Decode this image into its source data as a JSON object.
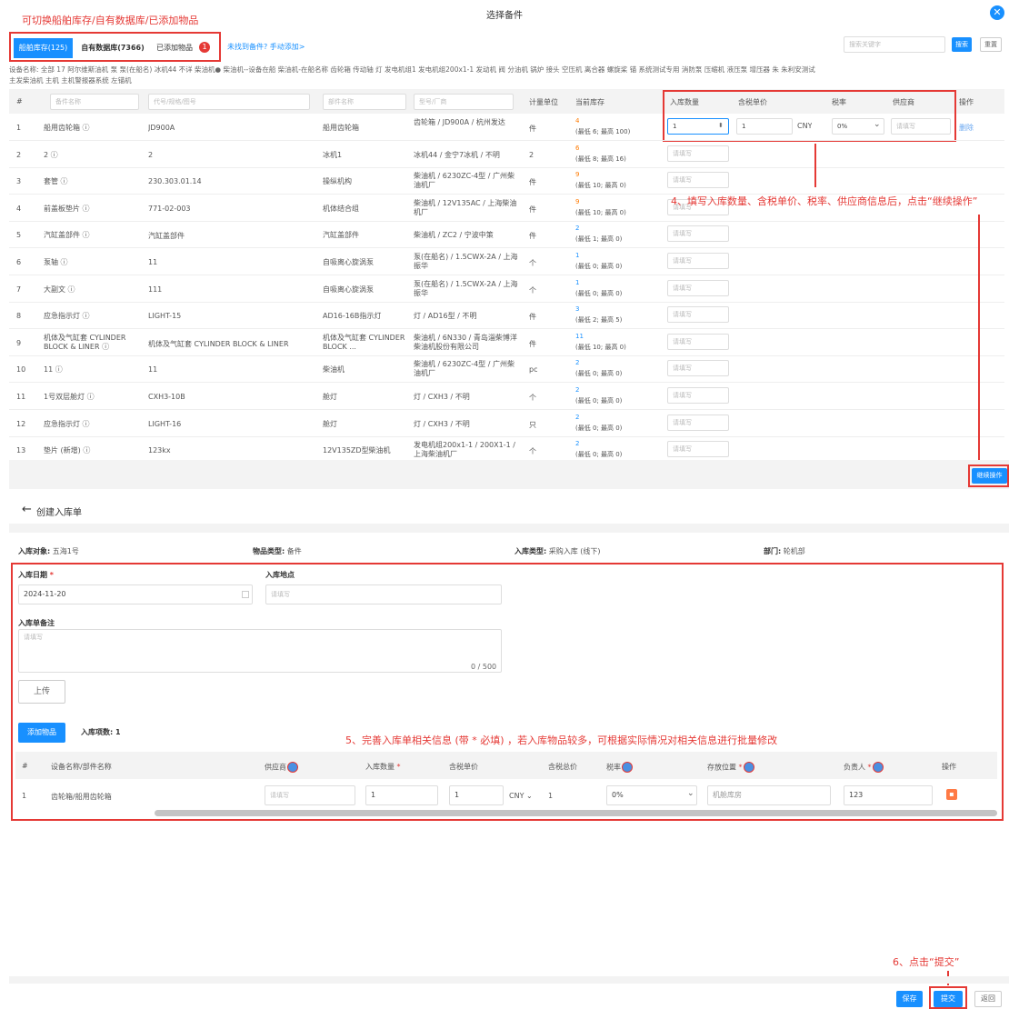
{
  "dialog": {
    "title": "选择备件",
    "annotation_top": "可切换船舶库存/自有数据库/已添加物品",
    "tabs": [
      {
        "label": "船舶库存(125)"
      },
      {
        "label": "自有数据库(7366)"
      },
      {
        "label": "已添加物品"
      }
    ],
    "added_badge": "1",
    "not_found_link": "未找到备件? 手动添加>",
    "search_placeholder": "搜索关键字",
    "search_button": "搜索",
    "reset_button": "重置",
    "filter_line1": "设备名称:  全部  17  阿尔维斯油机  泵  泵(在船名)  冰机44  不详  柴油机●  柴油机--设备在船  柴油机-在船名称  齿轮箱  传动轴  灯  发电机组1  发电机组200x1-1  发动机  阀  分油机  锅炉  接头  空压机  离合器  螺旋桨  锚  系统测试专用  消防泵  压缩机  液压泵  增压器  朱  朱利安测试",
    "filter_line2": "主发柴油机  主机  主机警报器系统  左锚机",
    "columns": [
      "#",
      "备件名称",
      "代号/规格/图号",
      "部件名称",
      "型号/厂商",
      "计量单位",
      "当前库存",
      "入库数量",
      "含税单价",
      "税率",
      "供应商",
      "操作"
    ],
    "col_placeholders": {
      "name": "备件名称",
      "code": "代号/规格/图号",
      "part": "部件名称",
      "model": "型号/厂商"
    },
    "rows": [
      {
        "no": "1",
        "name": "船用齿轮箱 ⓘ",
        "code": "JD900A",
        "part": "船用齿轮箱",
        "model": "齿轮箱 / JD900A / 杭州发达",
        "unit": "件",
        "stock": "4",
        "range": "(最低 6; 最高 100)",
        "qty": "1",
        "price": "1",
        "currency": "CNY",
        "tax": "0%",
        "supplier": "请填写",
        "op": "删除"
      },
      {
        "no": "2",
        "name": "2 ⓘ",
        "code": "2",
        "part": "冰机1",
        "model": "冰机44 / 金宁7冰机 / 不明",
        "unit": "2",
        "stock": "6",
        "range": "(最低 8; 最高 16)",
        "qty": "请填写"
      },
      {
        "no": "3",
        "name": "套管 ⓘ",
        "code": "230.303.01.14",
        "part": "操纵机构",
        "model": "柴油机 / 6230ZC-4型 / 广州柴油机厂",
        "unit": "件",
        "stock": "9",
        "range": "(最低 10; 最高 0)",
        "qty": "请填写"
      },
      {
        "no": "4",
        "name": "前盖板垫片 ⓘ",
        "code": "771-02-003",
        "part": "机体结合组",
        "model": "柴油机 / 12V135AC / 上海柴油机厂",
        "unit": "件",
        "stock": "9",
        "range": "(最低 10; 最高 0)",
        "qty": "请填写"
      },
      {
        "no": "5",
        "name": "汽缸盖部件 ⓘ",
        "code": "汽缸盖部件",
        "part": "汽缸盖部件",
        "model": "柴油机 / ZC2 / 宁波中策",
        "unit": "件",
        "stock": "2",
        "range": "(最低 1; 最高 0)",
        "qty": "请填写"
      },
      {
        "no": "6",
        "name": "泵轴 ⓘ",
        "code": "11",
        "part": "自吸离心旋涡泵",
        "model": "泵(在船名) / 1.5CWX-2A / 上海振华",
        "unit": "个",
        "stock": "1",
        "range": "(最低 0; 最高 0)",
        "qty": "请填写"
      },
      {
        "no": "7",
        "name": "大副文 ⓘ",
        "code": "111",
        "part": "自吸离心旋涡泵",
        "model": "泵(在船名) / 1.5CWX-2A / 上海振华",
        "unit": "个",
        "stock": "1",
        "range": "(最低 0; 最高 0)",
        "qty": "请填写"
      },
      {
        "no": "8",
        "name": "应急指示灯 ⓘ",
        "code": "LIGHT-15",
        "part": "AD16-16B指示灯",
        "model": "灯 / AD16型 / 不明",
        "unit": "件",
        "stock": "3",
        "range": "(最低 2; 最高 5)",
        "qty": "请填写"
      },
      {
        "no": "9",
        "name": "机体及气缸套 CYLINDER BLOCK & LINER ⓘ",
        "code": "机体及气缸套 CYLINDER BLOCK & LINER",
        "part": "机体及气缸套 CYLINDER BLOCK ...",
        "model": "柴油机 / 6N330 / 青岛淄柴博洋柴油机股份有限公司",
        "unit": "件",
        "stock": "11",
        "range": "(最低 10; 最高 0)",
        "qty": "请填写"
      },
      {
        "no": "10",
        "name": "11 ⓘ",
        "code": "11",
        "part": "柴油机",
        "model": "柴油机 / 6230ZC-4型 / 广州柴油机厂",
        "unit": "pc",
        "stock": "2",
        "range": "(最低 0; 最高 0)",
        "qty": "请填写"
      },
      {
        "no": "11",
        "name": "1号双层舱灯 ⓘ",
        "code": "CXH3-10B",
        "part": "舱灯",
        "model": "灯 / CXH3 / 不明",
        "unit": "个",
        "stock": "2",
        "range": "(最低 0; 最高 0)",
        "qty": "请填写"
      },
      {
        "no": "12",
        "name": "应急指示灯 ⓘ",
        "code": "LIGHT-16",
        "part": "舱灯",
        "model": "灯 / CXH3 / 不明",
        "unit": "只",
        "stock": "2",
        "range": "(最低 0; 最高 0)",
        "qty": "请填写"
      },
      {
        "no": "13",
        "name": "垫片 (新增) ⓘ",
        "code": "123kx",
        "part": "12V135ZD型柴油机",
        "model": "发电机组200x1-1 / 200X1-1 / 上海柴油机厂",
        "unit": "个",
        "stock": "2",
        "range": "(最低 0; 最高 0)",
        "qty": "请填写"
      }
    ],
    "annotation_step4": "4、填写入库数量、含税单价、税率、供应商信息后，点击“继续操作”",
    "continue_button": "继续操作"
  },
  "form": {
    "back_title": "创建入库单",
    "info": [
      {
        "label": "入库对象:",
        "value": "五海1号"
      },
      {
        "label": "物品类型:",
        "value": "备件"
      },
      {
        "label": "入库类型:",
        "value": "采购入库 (线下)"
      },
      {
        "label": "部门:",
        "value": "轮机部"
      }
    ],
    "date_label": "入库日期",
    "date_value": "2024-11-20",
    "location_label": "入库地点",
    "location_placeholder": "请填写",
    "remark_label": "入库单备注",
    "remark_placeholder": "请填写",
    "remark_counter": "0 / 500",
    "upload_button": "上传",
    "add_item_button": "添加物品",
    "item_count": "入库项数: 1",
    "annotation_step5": "5、完善入库单相关信息 (带 * 必填) ，若入库物品较多，可根据实际情况对相关信息进行批量修改",
    "columns": [
      "#",
      "设备名称/部件名称",
      "供应商",
      "入库数量",
      "含税单价",
      "含税总价",
      "税率",
      "存放位置",
      "负责人",
      "操作"
    ],
    "row": {
      "no": "1",
      "name": "齿轮箱/船用齿轮箱",
      "supplier": "请填写",
      "qty": "1",
      "price": "1",
      "currency": "CNY",
      "total": "1",
      "tax": "0%",
      "location": "机舱库房",
      "owner": "123"
    }
  },
  "footer": {
    "annotation_step6": "6、点击“提交”",
    "save_button": "保存",
    "submit_button": "提交",
    "back_button": "返回"
  },
  "colors": {
    "accent": "#1890ff",
    "annotation": "#e53935",
    "stock_warning": "#ff7a00"
  }
}
